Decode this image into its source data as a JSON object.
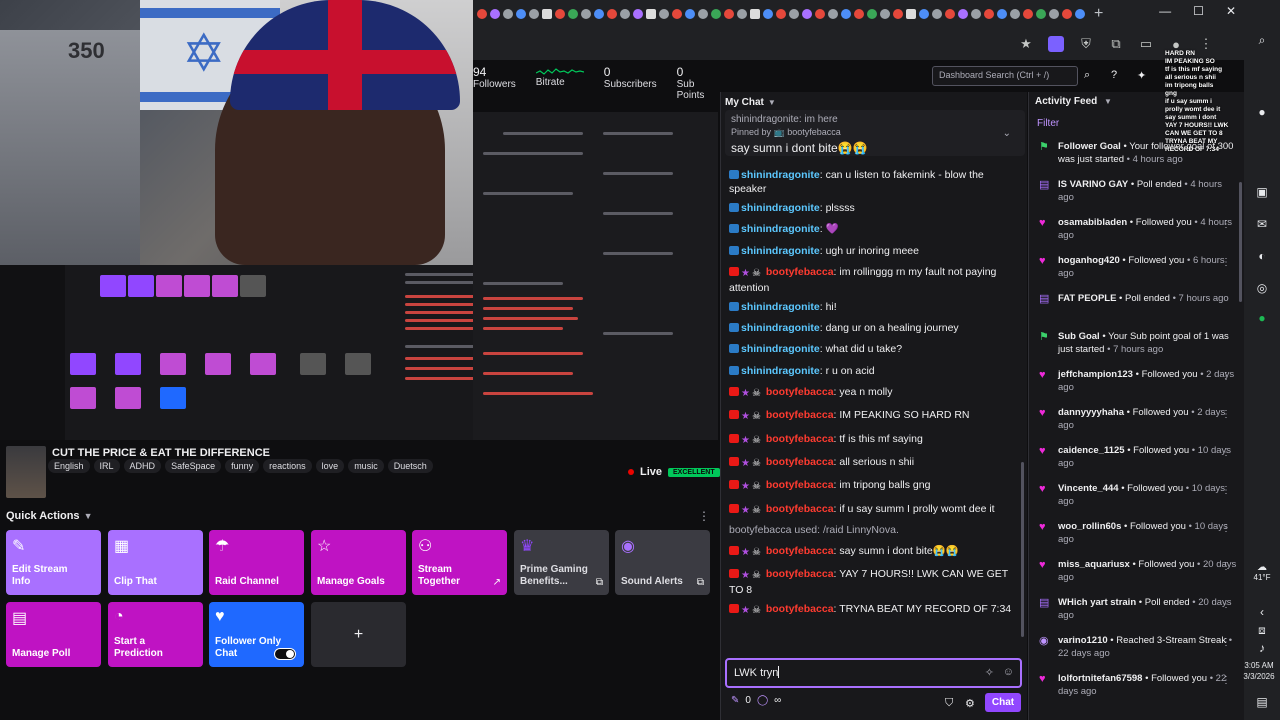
{
  "browser": {
    "new_tab": "+",
    "window_controls": [
      "—",
      "☐",
      "✕"
    ]
  },
  "stats": {
    "followers_num": "94",
    "followers_label": "Followers",
    "bitrate_label": "Bitrate",
    "subscribers_num": "0",
    "subscribers_label": "Subscribers",
    "subpoints_num": "0",
    "subpoints_label": "Sub Points"
  },
  "dashboard_search": {
    "placeholder": "Dashboard Search (Ctrl + /)"
  },
  "webcam": {
    "box_label": "350"
  },
  "stream": {
    "title": "CUT THE PRICE & EAT THE DIFFERENCE",
    "tags": [
      "English",
      "IRL",
      "ADHD",
      "SafeSpace",
      "funny",
      "reactions",
      "love",
      "music",
      "Duetsch"
    ],
    "live_label": "Live",
    "quality_badge": "EXCELLENT"
  },
  "quick_actions": {
    "title": "Quick Actions",
    "tiles": [
      {
        "label": "Edit Stream Info"
      },
      {
        "label": "Clip That"
      },
      {
        "label": "Raid Channel"
      },
      {
        "label": "Manage Goals"
      },
      {
        "label": "Stream Together"
      },
      {
        "label": "Prime Gaming Benefits..."
      },
      {
        "label": "Sound Alerts"
      },
      {
        "label": "Manage Poll"
      },
      {
        "label": "Start a Prediction"
      },
      {
        "label": "Follower Only Chat"
      }
    ],
    "add_label": "+"
  },
  "chat": {
    "header": "My Chat",
    "pinned_partial": "shinindragonite: im here",
    "pinned_by": "Pinned by 📺 bootyfebacca",
    "pinned_message": "say sumn i dont bite😭😭",
    "lines": [
      {
        "user": "shinindragonite",
        "text": ": can u listen to fakemink - blow the speaker"
      },
      {
        "user": "shinindragonite",
        "text": ": plssss"
      },
      {
        "user": "shinindragonite",
        "text": ":"
      },
      {
        "user": "shinindragonite",
        "text": ": ugh ur inoring meee"
      },
      {
        "user": "bootyfebacca",
        "text": ": im rollinggg rn my fault not paying attention"
      },
      {
        "user": "shinindragonite",
        "text": ": hi!"
      },
      {
        "user": "shinindragonite",
        "text": ": dang ur on a healing journey"
      },
      {
        "user": "shinindragonite",
        "text": ": what did u take?"
      },
      {
        "user": "shinindragonite",
        "text": ": r u on acid"
      },
      {
        "user": "bootyfebacca",
        "text": ": yea n molly"
      },
      {
        "user": "bootyfebacca",
        "text": ": IM PEAKING SO HARD RN"
      },
      {
        "user": "bootyfebacca",
        "text": ": tf is this mf saying"
      },
      {
        "user": "bootyfebacca",
        "text": ": all serious n shii"
      },
      {
        "user": "bootyfebacca",
        "text": ": im tripong balls gng"
      },
      {
        "user": "bootyfebacca",
        "text": ": if u say summ I prolly womt dee it"
      },
      {
        "system": "bootyfebacca used: /raid LinnyNova."
      },
      {
        "user": "bootyfebacca",
        "text": ": say sumn i dont bite😭😭"
      },
      {
        "user": "bootyfebacca",
        "text": ": YAY 7 HOURS!! LWK CAN WE GET TO 8"
      },
      {
        "user": "bootyfebacca",
        "text": ": TRYNA BEAT MY RECORD OF 7:34"
      }
    ],
    "input_value": "LWK tryn",
    "points": "0",
    "infinity": "∞",
    "send_label": "Chat"
  },
  "activity": {
    "header": "Activity Feed",
    "filter_label": "Filter",
    "items": [
      {
        "type": "goal",
        "name": "Follower Goal",
        "text": " • Your follower goal of 300 was just started",
        "time": " • 4 hours ago"
      },
      {
        "type": "poll",
        "name": "IS VARINO GAY",
        "text": " • Poll ended",
        "time": " • 4 hours ago"
      },
      {
        "type": "follow",
        "name": "osamabibladen",
        "text": " • Followed you",
        "time": " • 4 hours ago"
      },
      {
        "type": "follow",
        "name": "hoganhog420",
        "text": " • Followed you",
        "time": " • 6 hours ago"
      },
      {
        "type": "poll",
        "name": "FAT PEOPLE",
        "text": " • Poll ended",
        "time": " • 7 hours ago"
      },
      {
        "type": "goal",
        "name": "Sub Goal",
        "text": " • Your Sub point goal of 1 was just started",
        "time": " • 7 hours ago"
      },
      {
        "type": "follow",
        "name": "jeffchampion123",
        "text": " • Followed you",
        "time": " • 2 days ago"
      },
      {
        "type": "follow",
        "name": "dannyyyyhaha",
        "text": " • Followed you",
        "time": " • 2 days ago"
      },
      {
        "type": "follow",
        "name": "caidence_1125",
        "text": " • Followed you",
        "time": " • 10 days ago"
      },
      {
        "type": "follow",
        "name": "Vincente_444",
        "text": " • Followed you",
        "time": " • 10 days ago"
      },
      {
        "type": "follow",
        "name": "woo_rollin60s",
        "text": " • Followed you",
        "time": " • 10 days ago"
      },
      {
        "type": "follow",
        "name": "miss_aquariusx",
        "text": " • Followed you",
        "time": " • 20 days ago"
      },
      {
        "type": "poll",
        "name": "WHich yart strain",
        "text": " • Poll ended",
        "time": " • 20 days ago"
      },
      {
        "type": "streak",
        "name": "varino1210",
        "text": " • Reached 3-Stream Streak",
        "time": " • 22 days ago"
      },
      {
        "type": "follow",
        "name": "lolfortnitefan67598",
        "text": " • Followed you",
        "time": " • 22 days ago"
      }
    ]
  },
  "overlay_chat": "HARD RN\nIM PEAKING SO\ntf is this mf saying\nall serious n shii\nim tripong balls\ngng\nif u say summ i\nprolly womt dee it\nsay summ i dont\nYAY 7 HOURS!! LWK\nCAN WE GET TO 8\nTRYNA BEAT MY\nRECORD OF 7:34",
  "system_tray": {
    "weather": "41°F",
    "time": "3:05 AM",
    "date": "3/3/2026"
  },
  "colors": {
    "accent_purple": "#9147ff",
    "magenta_tile": "#bf13c3",
    "follower_only_blue": "#1f69ff",
    "live_red": "#eb0400",
    "excellent_green": "#00c85a"
  }
}
